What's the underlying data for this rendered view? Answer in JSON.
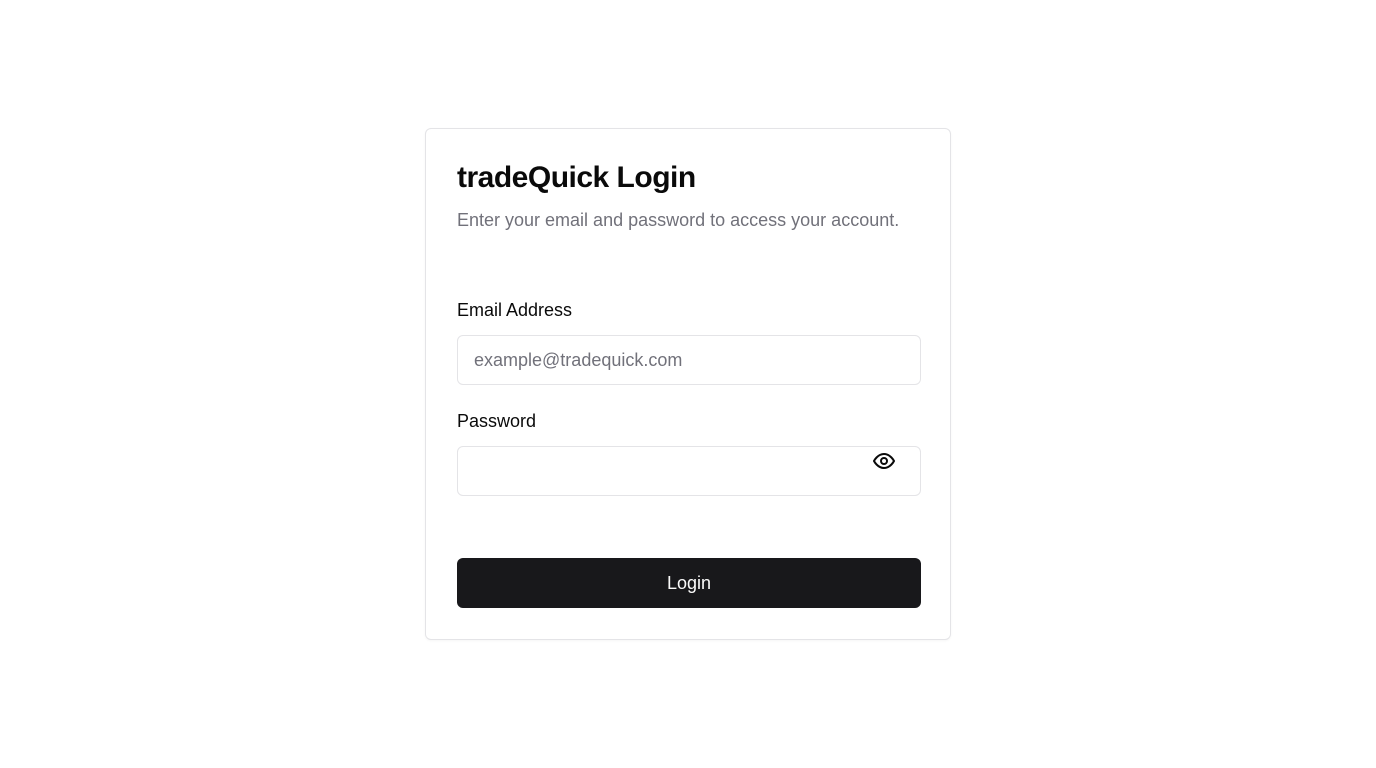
{
  "login_card": {
    "title": "tradeQuick Login",
    "subtitle": "Enter your email and password to access your account.",
    "email": {
      "label": "Email Address",
      "value": "",
      "placeholder": "example@tradequick.com"
    },
    "password": {
      "label": "Password",
      "value": "",
      "placeholder": "",
      "toggle_icon": "eye-icon"
    },
    "submit_label": "Login"
  },
  "colors": {
    "background": "#ffffff",
    "card_border": "#e4e4e7",
    "muted_text": "#71717a",
    "button_bg": "#18181b",
    "button_text": "#fafafa"
  }
}
